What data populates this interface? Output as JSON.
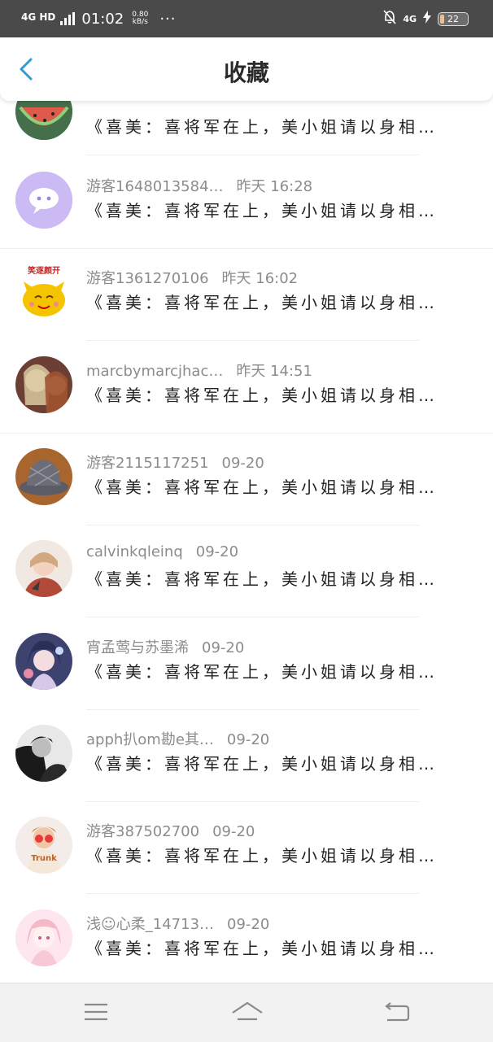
{
  "status_bar": {
    "network": "4G HD",
    "time": "01:02",
    "speed_value": "0.80",
    "speed_unit": "kB/s",
    "dots": "···",
    "network_right": "4G",
    "battery": "22"
  },
  "header": {
    "title": "收藏"
  },
  "items": [
    {
      "user": "游客1648013584…",
      "time": "昨天 16:28",
      "desc": "《喜美：喜将军在上，美小姐请以身相…",
      "avatar_color": "#c9b8f0"
    },
    {
      "user": "游客1361270106",
      "time": "昨天 16:02",
      "desc": "《喜美：喜将军在上，美小姐请以身相…",
      "avatar_label": "笑逐颜开",
      "avatar_color": "#f5c400"
    },
    {
      "user": "marcbymarcjhac…",
      "time": "昨天 14:51",
      "desc": "《喜美：喜将军在上，美小姐请以身相…",
      "avatar_color": "#7a4a3a"
    },
    {
      "user": "游客2115117251",
      "time": "09-20",
      "desc": "《喜美：喜将军在上，美小姐请以身相…",
      "avatar_color": "#6c6c78"
    },
    {
      "user": "calvinkqleinq",
      "time": "09-20",
      "desc": "《喜美：喜将军在上，美小姐请以身相…",
      "avatar_color": "#e8c9b8"
    },
    {
      "user": "宵孟莺与苏墨浠",
      "time": "09-20",
      "desc": "《喜美：喜将军在上，美小姐请以身相…",
      "avatar_color": "#5a5f9a"
    },
    {
      "user": "apph扒om勘e其…",
      "time": "09-20",
      "desc": "《喜美：喜将军在上，美小姐请以身相…",
      "avatar_color": "#2b2b2b"
    },
    {
      "user": "游客387502700",
      "time": "09-20",
      "desc": "《喜美：喜将军在上，美小姐请以身相…",
      "avatar_label": "Trunk",
      "avatar_color": "#e8b9a8"
    },
    {
      "user": "浅☺心柔_14713…",
      "time": "09-20",
      "desc": "《喜美：喜将军在上，美小姐请以身相…",
      "avatar_color": "#f7d6e0"
    }
  ],
  "partial_item": {
    "desc": "《喜美：喜将军在上，美小姐请以身相…",
    "avatar_color": "#4a8a5a"
  },
  "navigation": {
    "menu_icon": "menu-icon",
    "home_icon": "home-icon",
    "back_icon": "back-icon"
  }
}
